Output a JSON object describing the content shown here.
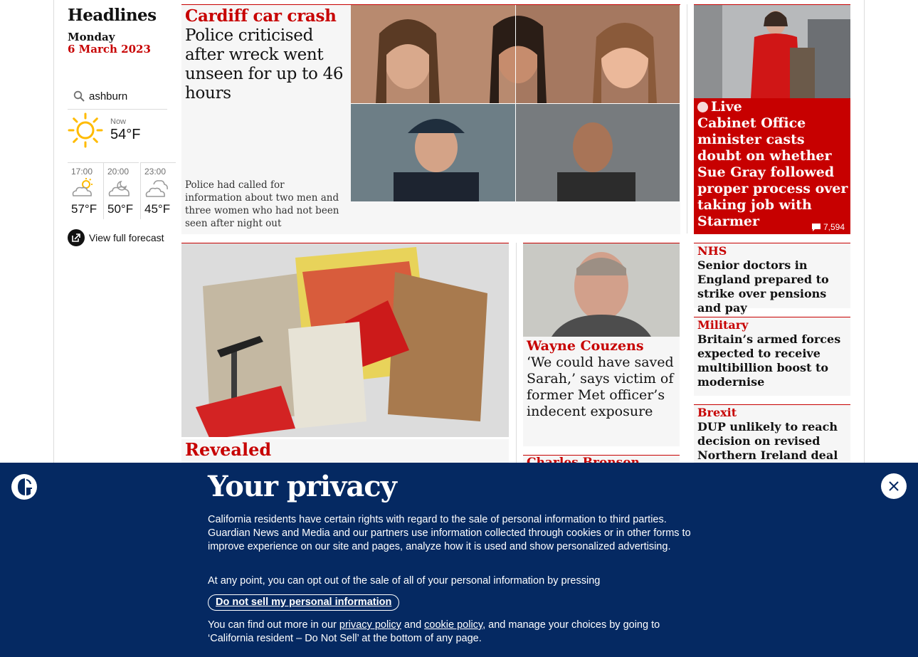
{
  "header": {
    "title": "Headlines",
    "day": "Monday",
    "date": "6 March 2023"
  },
  "weather": {
    "location": "ashburn",
    "now_label": "Now",
    "now_temp": "54°F",
    "forecast": [
      {
        "time": "17:00",
        "temp": "57°F",
        "icon": "partly-sunny-icon"
      },
      {
        "time": "20:00",
        "temp": "50°F",
        "icon": "cloud-moon-icon"
      },
      {
        "time": "23:00",
        "temp": "45°F",
        "icon": "cloudy-moon-icon"
      }
    ],
    "full_forecast_label": "View full forecast"
  },
  "stories": {
    "main": {
      "kicker": "Cardiff car crash",
      "headline": "Police criticised after wreck went unseen for up to 46 hours",
      "standfirst": "Police had called for information about two men and three women who had not been seen after night out"
    },
    "live": {
      "kicker": "Live",
      "headline": "Cabinet Office minister casts doubt on whether Sue Gray followed proper process over taking job with Starmer",
      "comments": "7,594"
    },
    "revealed": {
      "kicker": "Revealed"
    },
    "couzens": {
      "kicker": "Wayne Couzens",
      "headline": "‘We could have saved Sarah,’ says victim of former Met officer’s indecent exposure"
    },
    "bronson": {
      "kicker": "Charles Bronson"
    },
    "sidebar": [
      {
        "kicker": "NHS",
        "headline": "Senior doctors in England prepared to strike over pensions and pay"
      },
      {
        "kicker": "Military",
        "headline": "Britain’s armed forces expected to receive multibillion boost to modernise"
      },
      {
        "kicker": "Brexit",
        "headline": "DUP unlikely to reach decision on revised Northern Ireland deal until"
      }
    ]
  },
  "privacy": {
    "title": "Your privacy",
    "paragraph1": "California residents have certain rights with regard to the sale of personal information to third parties. Guardian News and Media and our partners use information collected through cookies or in other forms to improve experience on our site and pages, analyze how it is used and show personalized advertising.",
    "paragraph2": "At any point, you can opt out of the sale of all of your personal information by pressing",
    "button": "Do not sell my personal information",
    "p3_before": "You can find out more in our ",
    "privacy_link": "privacy policy",
    "p3_and": " and ",
    "cookie_link": "cookie policy",
    "p3_after": ", and manage your choices by going to ‘California resident – Do Not Sell’ at the bottom of any page."
  },
  "colors": {
    "accent": "#c70000",
    "banner": "#052962",
    "card": "#f6f6f6"
  }
}
